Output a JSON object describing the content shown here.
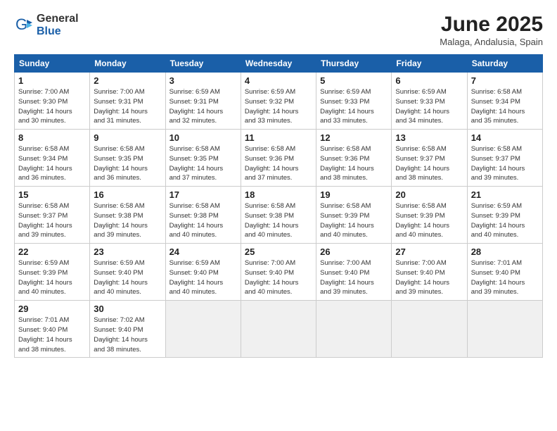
{
  "logo": {
    "general": "General",
    "blue": "Blue"
  },
  "title": "June 2025",
  "location": "Malaga, Andalusia, Spain",
  "weekdays": [
    "Sunday",
    "Monday",
    "Tuesday",
    "Wednesday",
    "Thursday",
    "Friday",
    "Saturday"
  ],
  "days": [
    {
      "num": "1",
      "info": "Sunrise: 7:00 AM\nSunset: 9:30 PM\nDaylight: 14 hours\nand 30 minutes."
    },
    {
      "num": "2",
      "info": "Sunrise: 7:00 AM\nSunset: 9:31 PM\nDaylight: 14 hours\nand 31 minutes."
    },
    {
      "num": "3",
      "info": "Sunrise: 6:59 AM\nSunset: 9:31 PM\nDaylight: 14 hours\nand 32 minutes."
    },
    {
      "num": "4",
      "info": "Sunrise: 6:59 AM\nSunset: 9:32 PM\nDaylight: 14 hours\nand 33 minutes."
    },
    {
      "num": "5",
      "info": "Sunrise: 6:59 AM\nSunset: 9:33 PM\nDaylight: 14 hours\nand 33 minutes."
    },
    {
      "num": "6",
      "info": "Sunrise: 6:59 AM\nSunset: 9:33 PM\nDaylight: 14 hours\nand 34 minutes."
    },
    {
      "num": "7",
      "info": "Sunrise: 6:58 AM\nSunset: 9:34 PM\nDaylight: 14 hours\nand 35 minutes."
    },
    {
      "num": "8",
      "info": "Sunrise: 6:58 AM\nSunset: 9:34 PM\nDaylight: 14 hours\nand 36 minutes."
    },
    {
      "num": "9",
      "info": "Sunrise: 6:58 AM\nSunset: 9:35 PM\nDaylight: 14 hours\nand 36 minutes."
    },
    {
      "num": "10",
      "info": "Sunrise: 6:58 AM\nSunset: 9:35 PM\nDaylight: 14 hours\nand 37 minutes."
    },
    {
      "num": "11",
      "info": "Sunrise: 6:58 AM\nSunset: 9:36 PM\nDaylight: 14 hours\nand 37 minutes."
    },
    {
      "num": "12",
      "info": "Sunrise: 6:58 AM\nSunset: 9:36 PM\nDaylight: 14 hours\nand 38 minutes."
    },
    {
      "num": "13",
      "info": "Sunrise: 6:58 AM\nSunset: 9:37 PM\nDaylight: 14 hours\nand 38 minutes."
    },
    {
      "num": "14",
      "info": "Sunrise: 6:58 AM\nSunset: 9:37 PM\nDaylight: 14 hours\nand 39 minutes."
    },
    {
      "num": "15",
      "info": "Sunrise: 6:58 AM\nSunset: 9:37 PM\nDaylight: 14 hours\nand 39 minutes."
    },
    {
      "num": "16",
      "info": "Sunrise: 6:58 AM\nSunset: 9:38 PM\nDaylight: 14 hours\nand 39 minutes."
    },
    {
      "num": "17",
      "info": "Sunrise: 6:58 AM\nSunset: 9:38 PM\nDaylight: 14 hours\nand 40 minutes."
    },
    {
      "num": "18",
      "info": "Sunrise: 6:58 AM\nSunset: 9:38 PM\nDaylight: 14 hours\nand 40 minutes."
    },
    {
      "num": "19",
      "info": "Sunrise: 6:58 AM\nSunset: 9:39 PM\nDaylight: 14 hours\nand 40 minutes."
    },
    {
      "num": "20",
      "info": "Sunrise: 6:58 AM\nSunset: 9:39 PM\nDaylight: 14 hours\nand 40 minutes."
    },
    {
      "num": "21",
      "info": "Sunrise: 6:59 AM\nSunset: 9:39 PM\nDaylight: 14 hours\nand 40 minutes."
    },
    {
      "num": "22",
      "info": "Sunrise: 6:59 AM\nSunset: 9:39 PM\nDaylight: 14 hours\nand 40 minutes."
    },
    {
      "num": "23",
      "info": "Sunrise: 6:59 AM\nSunset: 9:40 PM\nDaylight: 14 hours\nand 40 minutes."
    },
    {
      "num": "24",
      "info": "Sunrise: 6:59 AM\nSunset: 9:40 PM\nDaylight: 14 hours\nand 40 minutes."
    },
    {
      "num": "25",
      "info": "Sunrise: 7:00 AM\nSunset: 9:40 PM\nDaylight: 14 hours\nand 40 minutes."
    },
    {
      "num": "26",
      "info": "Sunrise: 7:00 AM\nSunset: 9:40 PM\nDaylight: 14 hours\nand 39 minutes."
    },
    {
      "num": "27",
      "info": "Sunrise: 7:00 AM\nSunset: 9:40 PM\nDaylight: 14 hours\nand 39 minutes."
    },
    {
      "num": "28",
      "info": "Sunrise: 7:01 AM\nSunset: 9:40 PM\nDaylight: 14 hours\nand 39 minutes."
    },
    {
      "num": "29",
      "info": "Sunrise: 7:01 AM\nSunset: 9:40 PM\nDaylight: 14 hours\nand 38 minutes."
    },
    {
      "num": "30",
      "info": "Sunrise: 7:02 AM\nSunset: 9:40 PM\nDaylight: 14 hours\nand 38 minutes."
    }
  ]
}
